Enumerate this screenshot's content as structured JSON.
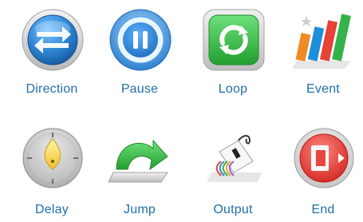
{
  "palette": {
    "label_color": "#1f6fa8",
    "direction_blue": "#2f88d6",
    "pause_blue": "#2f8fe0",
    "loop_green": "#2fa83a",
    "jump_green": "#39b54a",
    "end_red": "#e8322e"
  },
  "tiles": [
    {
      "label": "Direction",
      "icon": "direction-arrows-icon"
    },
    {
      "label": "Pause",
      "icon": "pause-icon"
    },
    {
      "label": "Loop",
      "icon": "loop-refresh-icon"
    },
    {
      "label": "Event",
      "icon": "event-bars-icon"
    },
    {
      "label": "Delay",
      "icon": "delay-flame-icon"
    },
    {
      "label": "Jump",
      "icon": "jump-arrow-icon"
    },
    {
      "label": "Output",
      "icon": "output-plug-icon"
    },
    {
      "label": "End",
      "icon": "end-exit-icon"
    }
  ]
}
